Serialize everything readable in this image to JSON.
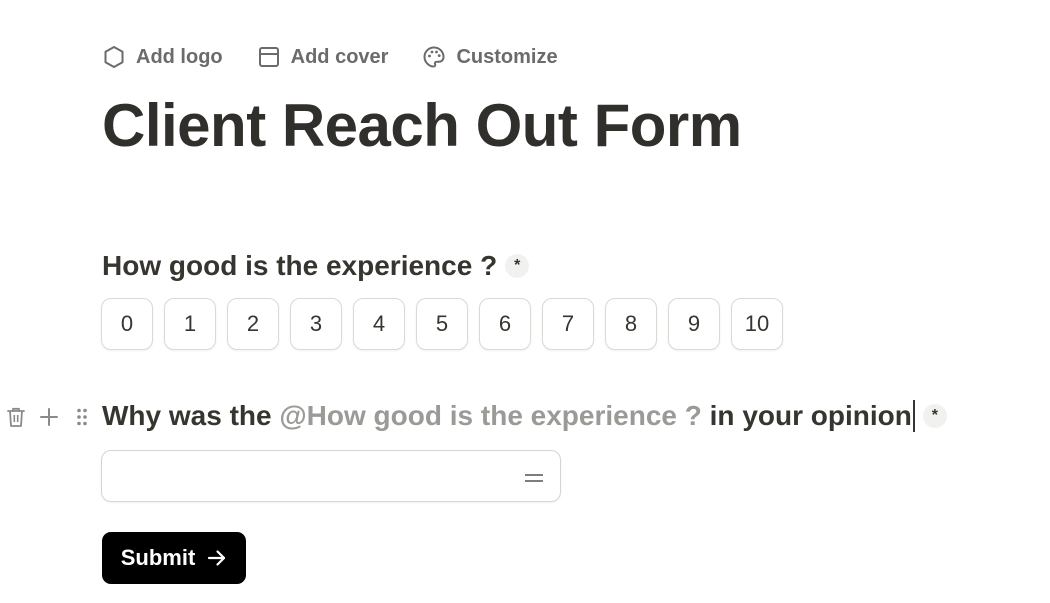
{
  "toolbar": {
    "add_logo": "Add logo",
    "add_cover": "Add cover",
    "customize": "Customize"
  },
  "form": {
    "title": "Client Reach Out Form",
    "question1": {
      "label": "How good is the experience ?",
      "required_mark": "*",
      "scale": [
        "0",
        "1",
        "2",
        "3",
        "4",
        "5",
        "6",
        "7",
        "8",
        "9",
        "10"
      ]
    },
    "question2": {
      "prefix": "Why was the",
      "mention": "@How good is the experience ?",
      "suffix": "in your opinion",
      "required_mark": "*",
      "input_value": ""
    },
    "submit_label": "Submit"
  },
  "icons": {
    "add_logo": "hexagon-icon",
    "add_cover": "cover-icon",
    "customize": "palette-icon",
    "delete": "trash-icon",
    "add_block": "plus-icon",
    "drag": "drag-handle-icon",
    "input_type": "equals-icon",
    "submit": "arrow-right-icon"
  },
  "colors": {
    "text": "#37352f",
    "muted": "#6b6b6b",
    "mention": "#9b9a97",
    "button_bg": "#000000",
    "button_text": "#ffffff"
  }
}
